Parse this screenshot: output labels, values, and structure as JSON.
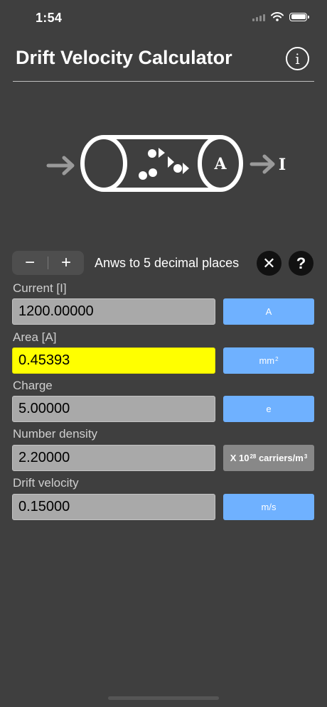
{
  "status_bar": {
    "time": "1:54"
  },
  "header": {
    "title": "Drift Velocity Calculator",
    "info_glyph": "i"
  },
  "diagram": {
    "area_label": "A",
    "current_label": "I"
  },
  "controls": {
    "minus": "−",
    "plus": "+",
    "decimal_label": "Anws to 5 decimal places",
    "clear": "✕",
    "help": "?"
  },
  "fields": {
    "current": {
      "label": "Current [I]",
      "value": "1200.00000",
      "unit": "A"
    },
    "area": {
      "label": "Area [A]",
      "value": "0.45393",
      "unit": "mm",
      "unit_sup": "2"
    },
    "charge": {
      "label": "Charge",
      "value": "5.00000",
      "unit": "e"
    },
    "density": {
      "label": "Number density",
      "value": "2.20000",
      "unit_prefix": "X 10",
      "unit_sup": "28",
      "unit_mid": " carriers/m",
      "unit_sup2": "3"
    },
    "drift": {
      "label": "Drift velocity",
      "value": "0.15000",
      "unit": "m/s"
    }
  },
  "colors": {
    "background": "#3f3f3f",
    "accent": "#6fb1ff",
    "highlight": "#ffff00"
  }
}
